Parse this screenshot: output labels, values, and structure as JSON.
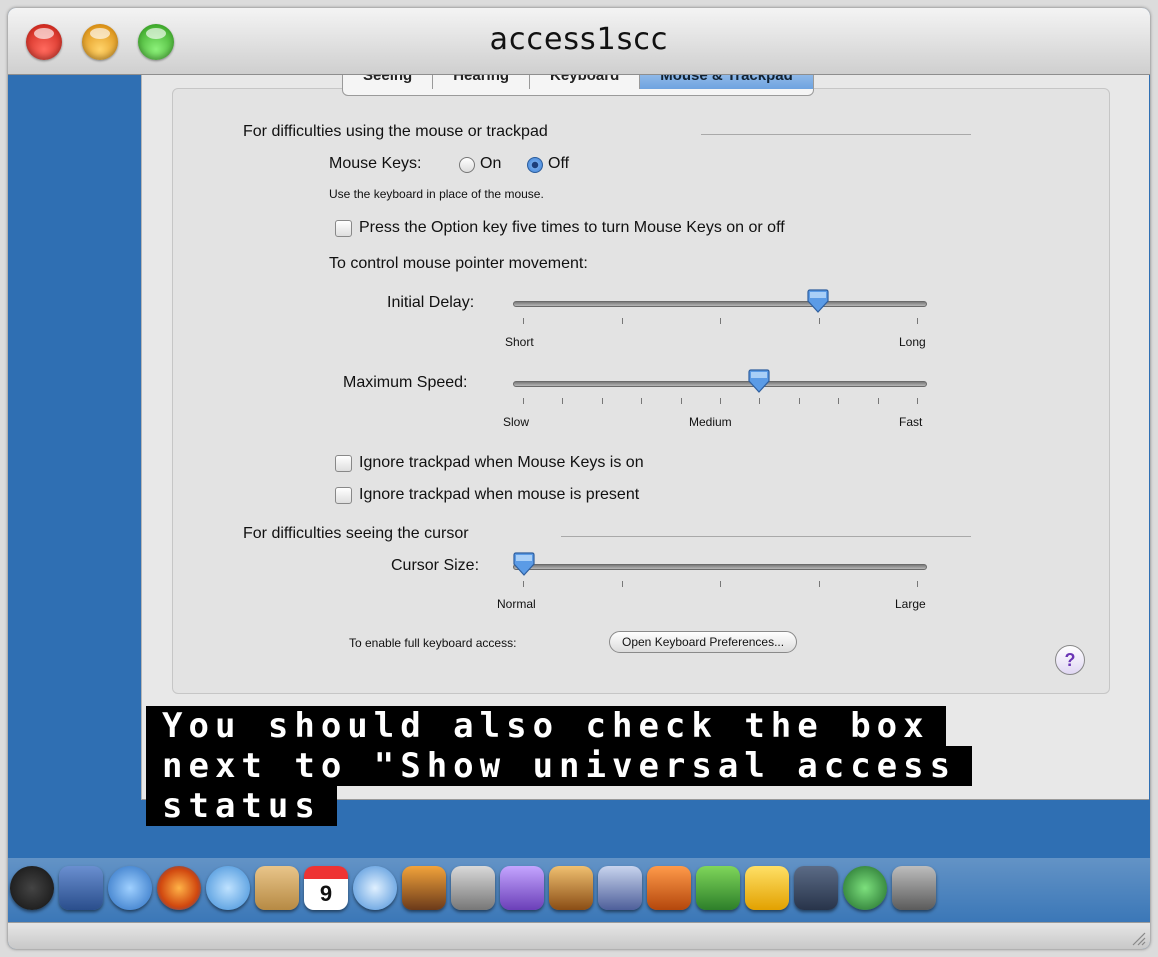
{
  "window": {
    "title": "access1scc"
  },
  "tabs": [
    "Seeing",
    "Hearing",
    "Keyboard",
    "Mouse & Trackpad"
  ],
  "active_tab": "Mouse & Trackpad",
  "section_mouse": {
    "heading": "For difficulties using the mouse or trackpad",
    "mouse_keys_label": "Mouse Keys:",
    "on_label": "On",
    "off_label": "Off",
    "selected": "Off",
    "hint": "Use the keyboard in place of the mouse.",
    "option_key_label": "Press the Option key five times to turn Mouse Keys on or off",
    "pointer_heading": "To control mouse pointer movement:",
    "initial_delay": {
      "label": "Initial Delay:",
      "min_label": "Short",
      "max_label": "Long",
      "value": 0.75
    },
    "max_speed": {
      "label": "Maximum Speed:",
      "min_label": "Slow",
      "mid_label": "Medium",
      "max_label": "Fast",
      "value": 0.6
    },
    "ignore_trackpad_mousekeys": "Ignore trackpad when Mouse Keys is on",
    "ignore_trackpad_mouse": "Ignore trackpad when mouse is present"
  },
  "section_cursor": {
    "heading": "For difficulties seeing the cursor",
    "cursor_size": {
      "label": "Cursor Size:",
      "min_label": "Normal",
      "max_label": "Large",
      "value": 0.0
    }
  },
  "keyboard_access": {
    "label": "To enable full keyboard access:",
    "button": "Open Keyboard Preferences..."
  },
  "help": "?",
  "caption": {
    "line1": "You should also check the box",
    "line2": "next to \"Show universal access",
    "line3": "status"
  },
  "dock_icons": [
    "dvd-player-icon",
    "preview-icon",
    "safari-icon",
    "firefox-icon",
    "ichat-icon",
    "address-book-icon",
    "ical-icon",
    "itunes-icon",
    "iphoto-icon",
    "imovie-icon",
    "idvd-icon",
    "garageband-icon",
    "iweb-icon",
    "keynote-icon",
    "numbers-icon",
    "pages-icon",
    "dashboard-icon",
    "time-machine-icon",
    "system-preferences-icon"
  ],
  "calendar_day": "9"
}
